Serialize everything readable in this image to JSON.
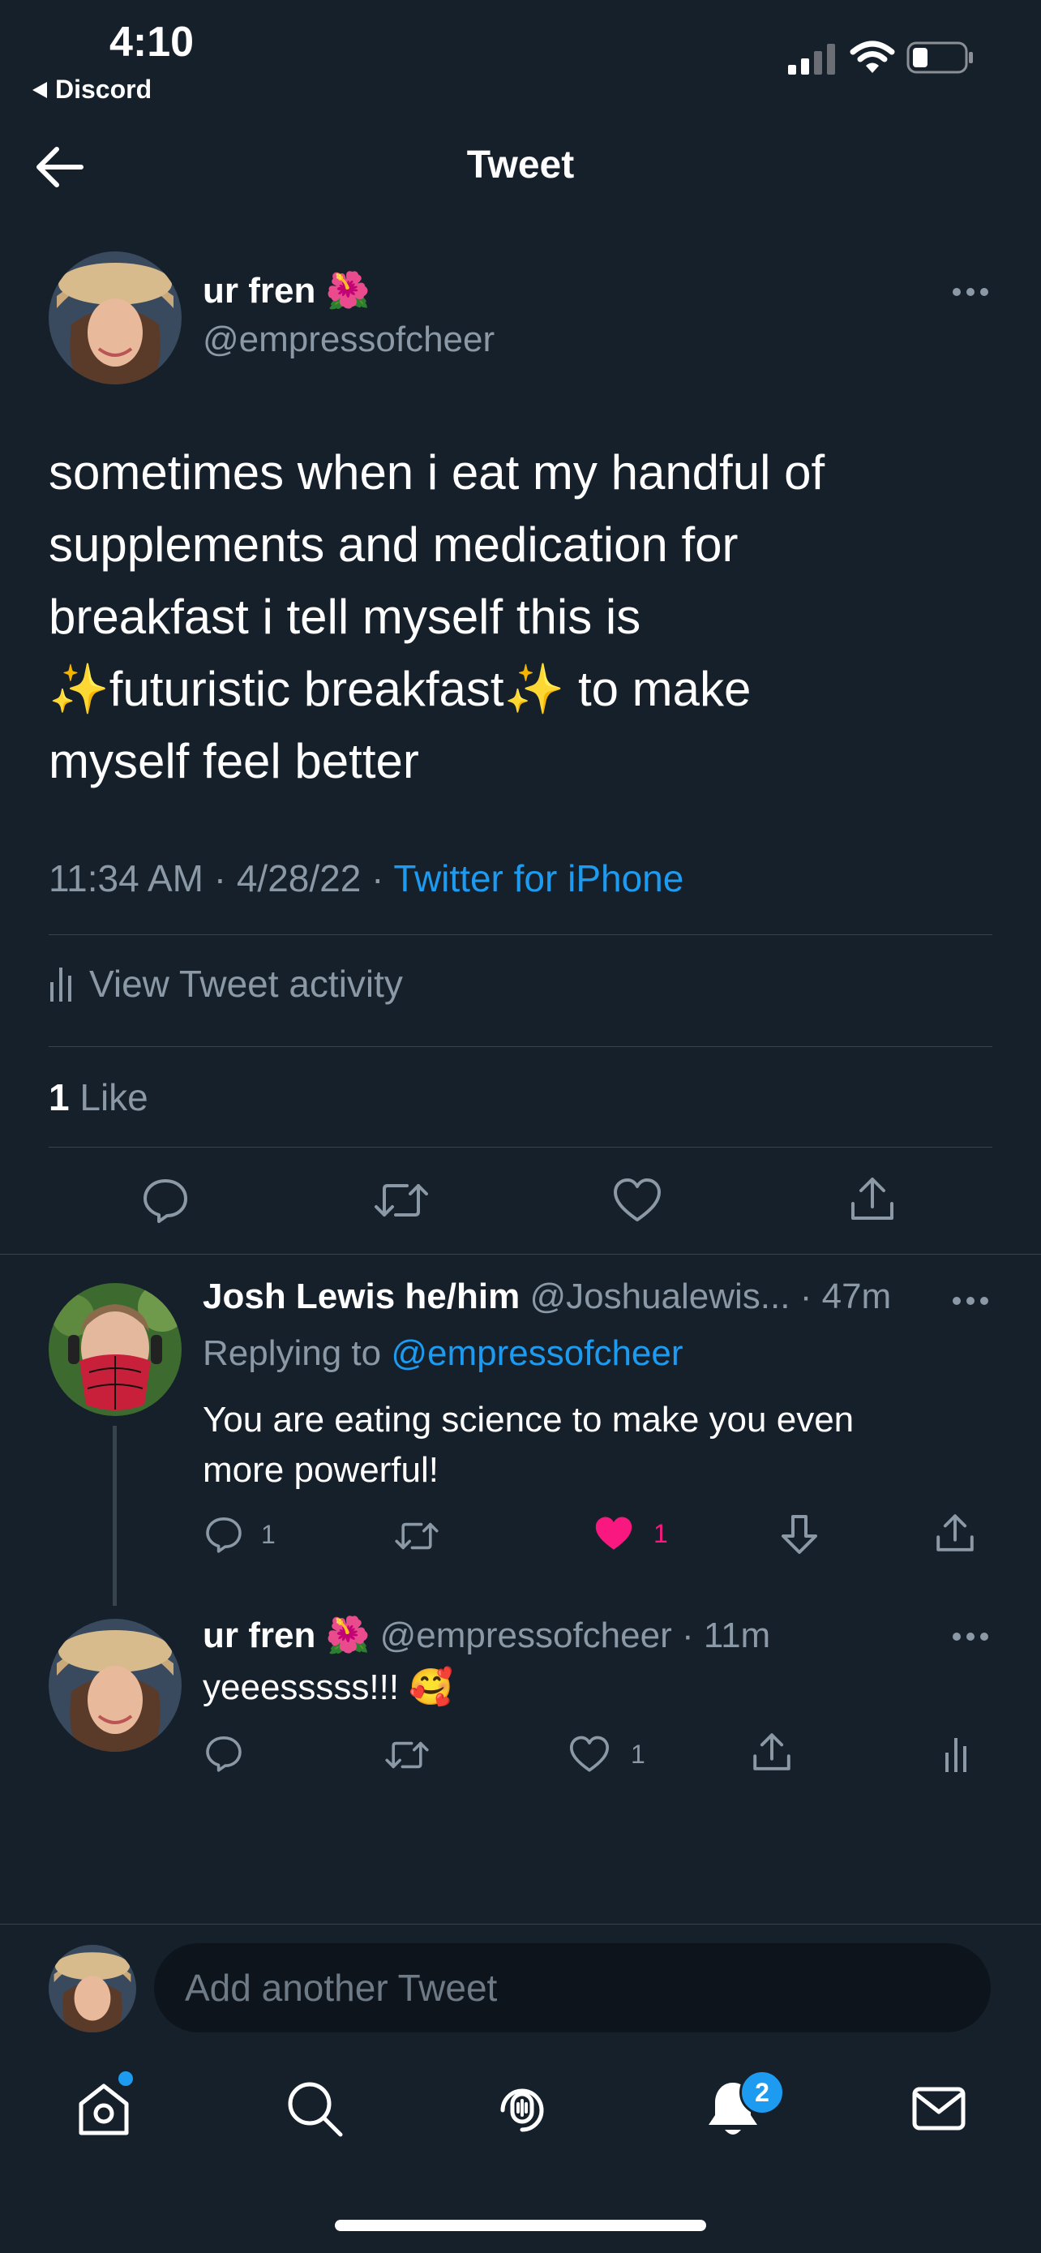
{
  "status_bar": {
    "time": "4:10",
    "back_app": "Discord"
  },
  "header": {
    "title": "Tweet"
  },
  "tweet": {
    "display_name": "ur fren 🌺",
    "handle": "@empressofcheer",
    "text_lines": [
      "sometimes when i eat my handful of",
      "supplements and medication for",
      "breakfast i tell myself this is",
      "✨futuristic breakfast✨  to make",
      "myself feel better"
    ],
    "time": "11:34 AM",
    "date": "4/28/22",
    "source": "Twitter for iPhone",
    "activity_label": "View Tweet activity",
    "like_count": "1",
    "like_label": "Like"
  },
  "replies": [
    {
      "display_name": "Josh Lewis he/him",
      "handle": "@Joshualewis...",
      "age": "47m",
      "replying_prefix": "Replying to",
      "replying_to": "@empressofcheer",
      "text_lines": [
        "You are eating science to make you even",
        "more powerful!"
      ],
      "reply_count": "1",
      "like_count": "1",
      "liked": true
    },
    {
      "display_name": "ur fren 🌺",
      "handle": "@empressofcheer",
      "age": "11m",
      "text": "yeeesssss!!! 🥰",
      "like_count": "1",
      "liked": false
    }
  ],
  "compose": {
    "placeholder": "Add another Tweet"
  },
  "tab_bar": {
    "notifications_badge": "2"
  },
  "colors": {
    "background": "#15202b",
    "accent": "#1d9bf0",
    "like": "#f91880",
    "muted": "#8b98a5",
    "divider": "#38444d"
  }
}
